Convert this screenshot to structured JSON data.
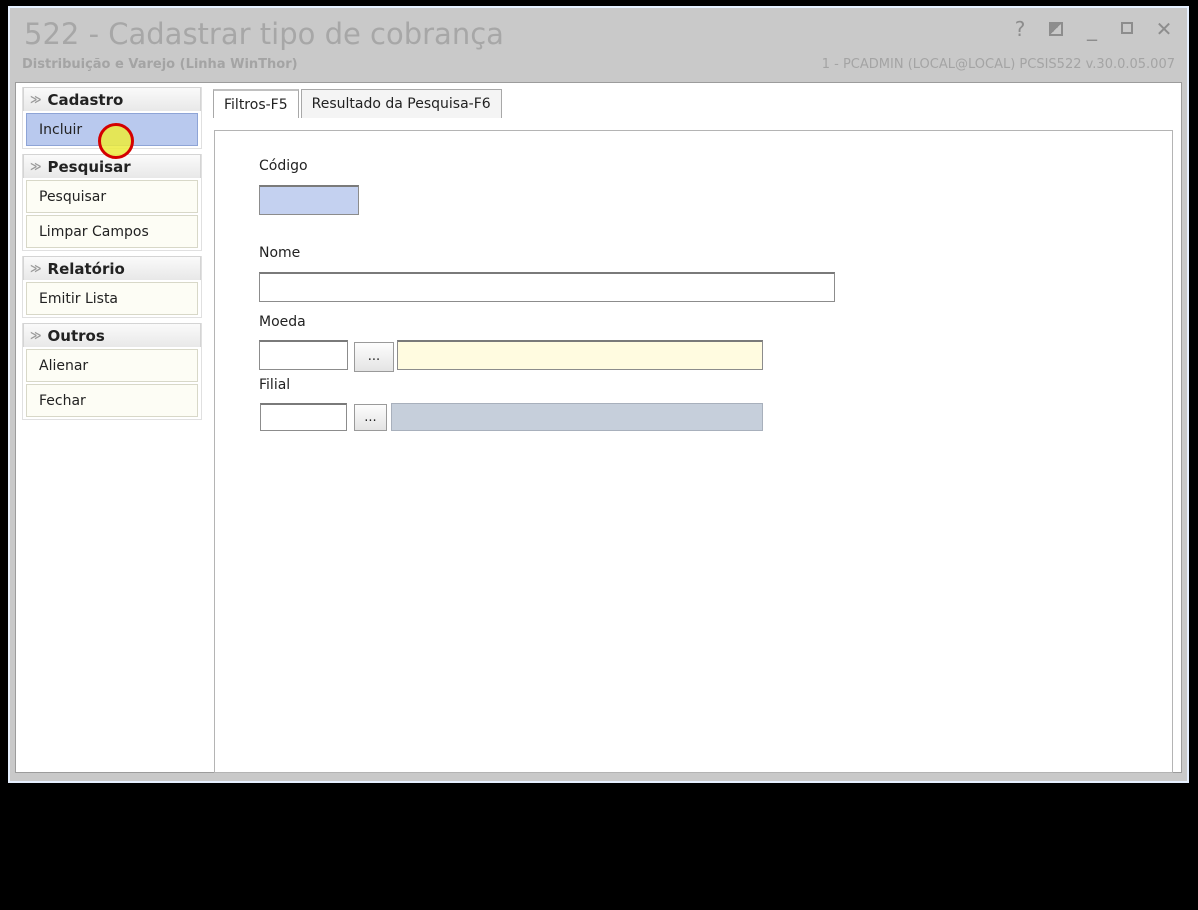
{
  "window": {
    "title": "522 - Cadastrar tipo de cobrança",
    "subtitle": "Distribuição e Varejo (Linha WinThor)",
    "session": "1 - PCADMIN (LOCAL@LOCAL)   PCSIS522  v.30.0.05.007",
    "controls": {
      "help": "?",
      "minimize": "_",
      "close": "✕"
    }
  },
  "sidebar": {
    "groups": [
      {
        "title": "Cadastro",
        "items": [
          {
            "label": "Incluir"
          }
        ]
      },
      {
        "title": "Pesquisar",
        "items": [
          {
            "label": "Pesquisar"
          },
          {
            "label": "Limpar Campos"
          }
        ]
      },
      {
        "title": "Relatório",
        "items": [
          {
            "label": "Emitir Lista"
          }
        ]
      },
      {
        "title": "Outros",
        "items": [
          {
            "label": "Alienar"
          },
          {
            "label": "Fechar"
          }
        ]
      }
    ],
    "chevron": "≫"
  },
  "tabs": [
    {
      "label": "Filtros-F5"
    },
    {
      "label": "Resultado da Pesquisa-F6"
    }
  ],
  "form": {
    "codigo": {
      "label": "Código",
      "value": ""
    },
    "nome": {
      "label": "Nome",
      "value": ""
    },
    "moeda": {
      "label": "Moeda",
      "code": "",
      "button": "...",
      "description": ""
    },
    "filial": {
      "label": "Filial",
      "code": "",
      "button": "...",
      "description": ""
    }
  },
  "colors": {
    "selected_item": "#b9c9ee",
    "codigo_bg": "#c4d1f0",
    "moeda_desc_bg": "#fffbe0",
    "filial_desc_bg": "#c6cfdb"
  }
}
